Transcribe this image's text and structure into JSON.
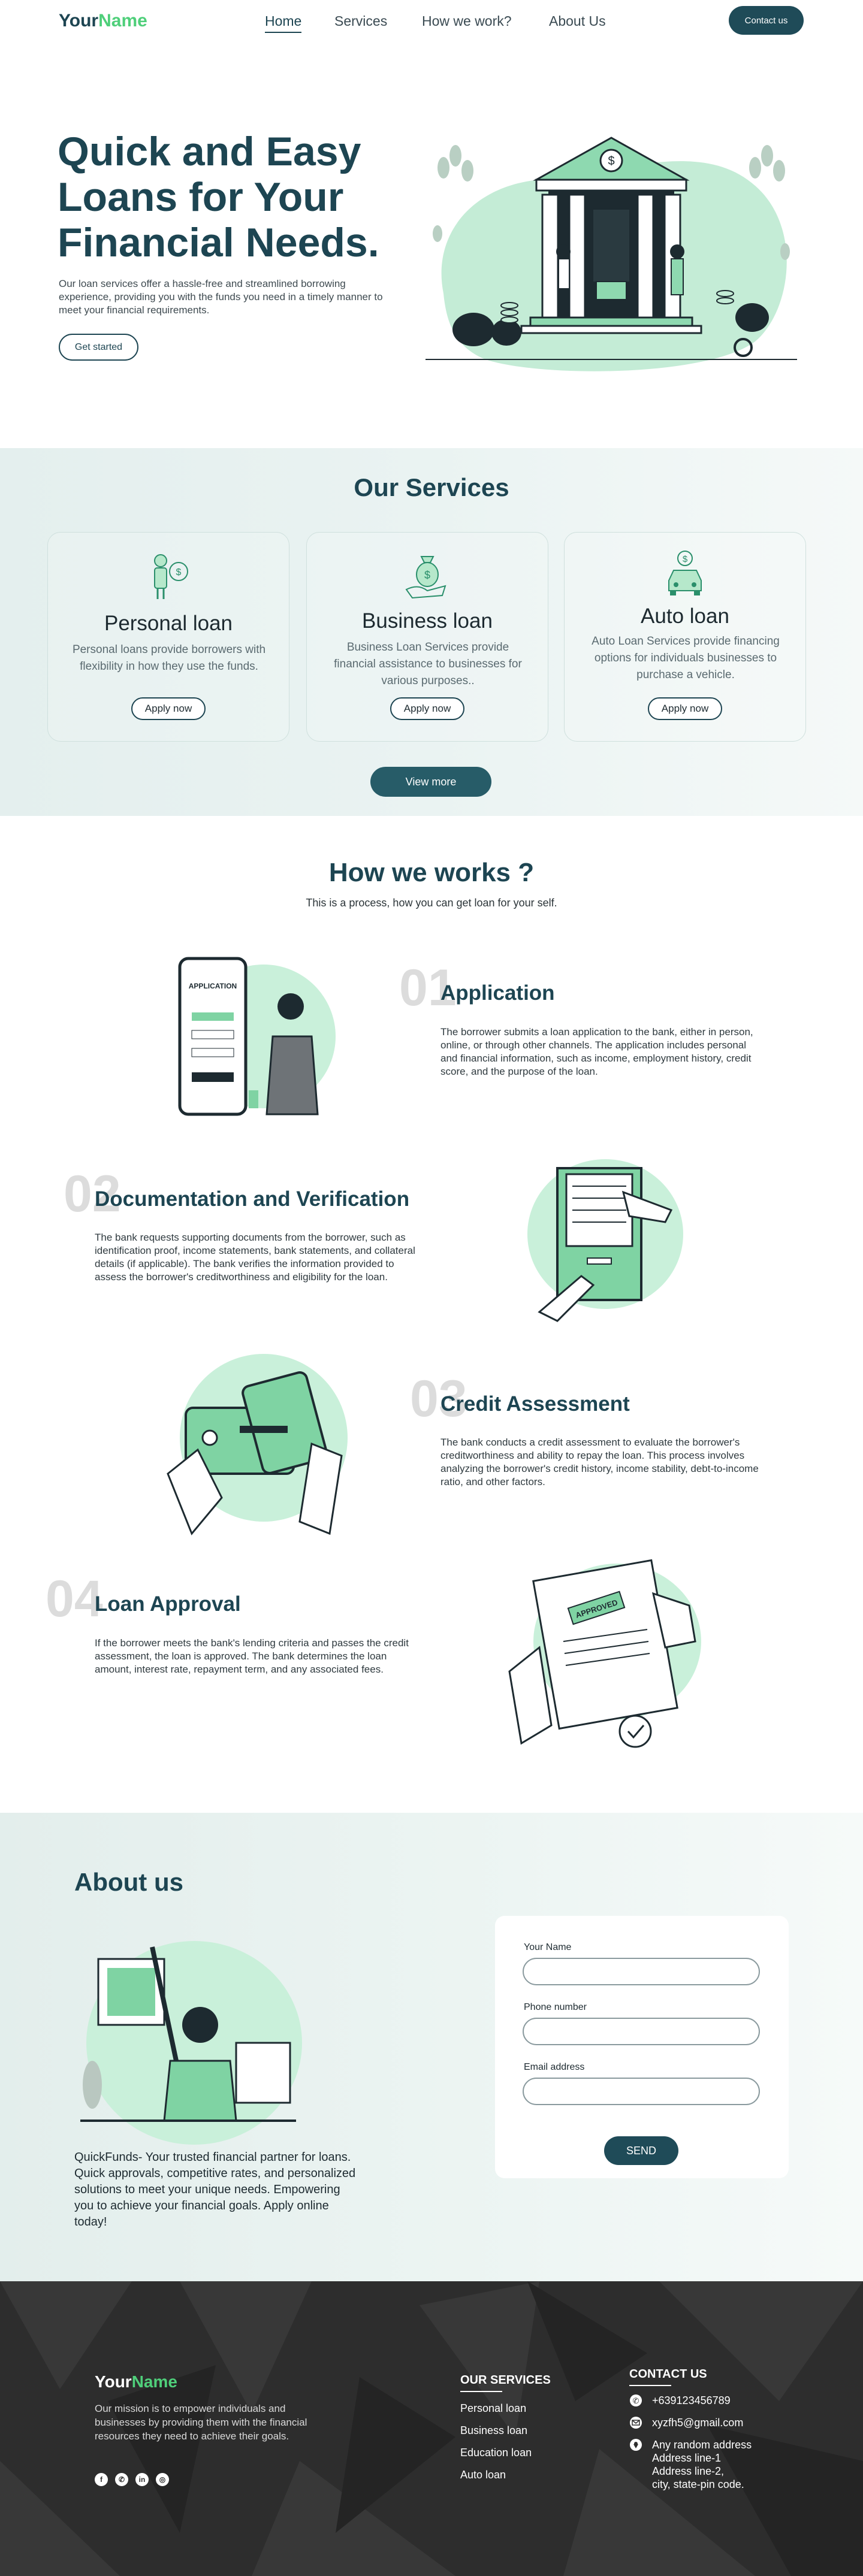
{
  "brand": {
    "part1": "Your",
    "part2": "Name"
  },
  "nav": {
    "items": [
      "Home",
      "Services",
      "How we work?",
      "About Us"
    ],
    "active": "Home",
    "contact": "Contact us"
  },
  "hero": {
    "title": "Quick and Easy Loans for Your Financial Needs.",
    "description": "Our loan services offer a hassle-free and streamlined borrowing experience, providing you with the funds you need in a timely manner to meet your financial requirements.",
    "cta": "Get started"
  },
  "services": {
    "title": "Our Services",
    "cards": [
      {
        "title": "Personal loan",
        "description": "Personal loans provide borrowers with flexibility in how they use the funds.",
        "button": "Apply now",
        "icon": "person-money-bag-icon"
      },
      {
        "title": "Business loan",
        "description": "Business Loan Services provide financial assistance to businesses for various purposes..",
        "button": "Apply now",
        "icon": "hand-money-bag-icon"
      },
      {
        "title": "Auto loan",
        "description": "Auto Loan Services provide financing options for individuals businesses to purchase a vehicle.",
        "button": "Apply now",
        "icon": "car-dollar-icon"
      }
    ],
    "view_more": "View more"
  },
  "how": {
    "title": "How we works ?",
    "subtitle": "This is a process, how you can get loan for your self.",
    "steps": [
      {
        "num": "01",
        "title": "Application",
        "description": "The borrower submits a loan application to the bank, either in person, online, or through other channels. The application includes personal and financial information, such as income, employment history, credit score, and the purpose of the loan."
      },
      {
        "num": "02",
        "title": "Documentation and Verification",
        "description": "The bank requests supporting documents from the borrower, such as identification proof, income statements, bank statements, and collateral details (if applicable). The bank verifies the information provided to assess the borrower's creditworthiness and eligibility for the loan."
      },
      {
        "num": "03",
        "title": "Credit Assessment",
        "description": "The bank conducts a credit assessment to evaluate the borrower's creditworthiness and ability to repay the loan. This process involves analyzing the borrower's credit history, income stability, debt-to-income ratio, and other factors."
      },
      {
        "num": "04",
        "title": "Loan Approval",
        "description": "If the borrower meets the bank's lending criteria and passes the credit assessment, the loan is approved. The bank determines the loan amount, interest rate, repayment term, and any associated fees."
      }
    ],
    "art_labels": {
      "application": "APPLICATION",
      "approved": "APPROVED"
    }
  },
  "about": {
    "title": "About us",
    "description": "QuickFunds- Your trusted financial partner for loans. Quick approvals, competitive rates, and personalized solutions to meet your unique needs. Empowering you to achieve your financial goals. Apply online today!",
    "form": {
      "name_label": "Your Name",
      "phone_label": "Phone number",
      "email_label": "Email address",
      "send": "SEND"
    }
  },
  "footer": {
    "mission": "Our mission is to empower individuals and businesses by providing them with the financial resources they need to achieve their goals.",
    "services_head": "OUR SERVICES",
    "services": [
      "Personal loan",
      "Business loan",
      "Education loan",
      "Auto loan"
    ],
    "contact_head": "CONTACT US",
    "phone": "+639123456789",
    "email": "xyzfh5@gmail.com",
    "address": [
      "Any random address",
      "Address line-1",
      "Address line-2,",
      "city, state-pin code."
    ],
    "socials": [
      "facebook-icon",
      "whatsapp-icon",
      "linkedin-icon",
      "instagram-icon"
    ]
  },
  "colors": {
    "primary": "#1d4552",
    "accent": "#4fcf7a",
    "mint": "#a9e6c3",
    "footer_bg": "#2d2d2d"
  }
}
